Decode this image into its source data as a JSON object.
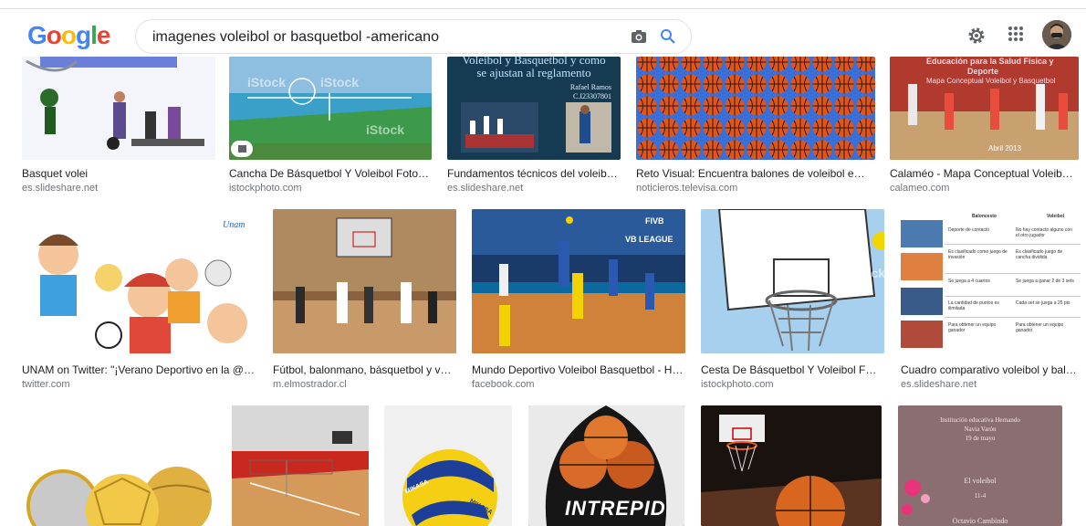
{
  "header": {
    "logo_letters": [
      "G",
      "o",
      "o",
      "g",
      "l",
      "e"
    ],
    "logo_colors": [
      "#4285f4",
      "#ea4335",
      "#fbbc05",
      "#4285f4",
      "#34a853",
      "#ea4335"
    ],
    "query": "imagenes voleibol or basquetbol -americano",
    "camera_icon": "camera-icon",
    "search_icon": "search-icon",
    "settings_icon": "gear-icon",
    "apps_icon": "apps-grid-icon"
  },
  "row1": [
    {
      "caption": "Basquet volei",
      "source": "es.slideshare.net"
    },
    {
      "caption": "Cancha De Básquetbol Y Voleibol Foto de ...",
      "source": "istockphoto.com",
      "wm": "iStock"
    },
    {
      "caption": "Fundamentos técnicos del voleibol ...",
      "source": "es.slideshare.net",
      "t1": "Voleibol y Basquetbol y como",
      "t2": "se ajustan al reglamento",
      "t3": "Rafael Ramos",
      "t4": "C.I23307801"
    },
    {
      "caption": "Reto Visual: Encuentra balones de voleibol entre b...",
      "source": "noticieros.televisa.com"
    },
    {
      "caption": "Calaméo - Mapa Conceptual Voleibol y ...",
      "source": "calameo.com",
      "t1": "Educación para la Salud Física y",
      "t2": "Deporte",
      "t3": "Mapa Conceptual Voleibol y Basquetbol",
      "t4": "Abril 2013"
    }
  ],
  "row2": [
    {
      "caption": "UNAM on Twitter: \"¡Verano Deportivo en la @FES...",
      "source": "twitter.com"
    },
    {
      "caption": "Fútbol, balonmano, básquetbol y vólei...",
      "source": "m.elmostrador.cl"
    },
    {
      "caption": "Mundo Deportivo Voleibol Basquetbol - Hom...",
      "source": "facebook.com",
      "t1": "FIVB",
      "t2": "VB LEAGUE"
    },
    {
      "caption": "Cesta De Básquetbol Y Voleibol Foto d...",
      "source": "istockphoto.com",
      "wm": "iStock"
    },
    {
      "caption": "Cuadro comparativo voleibol y balon...",
      "source": "es.slideshare.net",
      "h1": "Baloncesto",
      "h2": "Voleibol",
      "rows": [
        [
          "Deporte de contacto",
          "No hay contacto alguno con el otro jugador"
        ],
        [
          "Es clasificado como juego de invasión",
          "Es clasificado juego de cancha dividida"
        ],
        [
          "Se juega a 4 cuartos",
          "Se juega a ganar 2 de 3 sets"
        ],
        [
          "La cantidad de puntos es ilimitada",
          "Cada set se juega a 25 pts"
        ],
        [
          "Para obtener un equipo ganador",
          "Para obtener un equipo ganador"
        ]
      ]
    }
  ],
  "row3": [
    {
      "t1": ""
    },
    {
      "t1": ""
    },
    {
      "t1": "MIKASA",
      "t2": "MIKASA"
    },
    {
      "t1": "INTREPID"
    },
    {
      "t1": ""
    },
    {
      "t1": "Institución educativa Hernando",
      "t2": "Navia Varón",
      "t3": "19 de mayo",
      "t4": "El voleibol",
      "t5": "11-4",
      "t6": "Octavio Cambindo"
    }
  ]
}
